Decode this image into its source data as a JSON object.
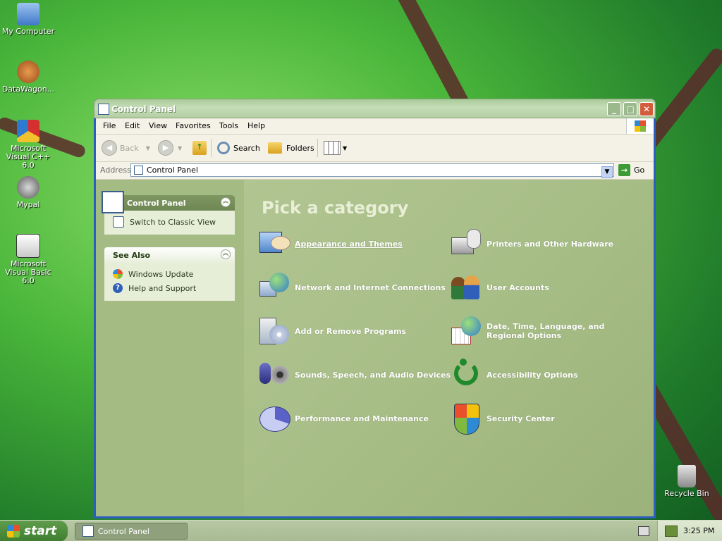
{
  "desktop": {
    "icons": [
      {
        "label": "My Computer"
      },
      {
        "label": "DataWagon..."
      },
      {
        "label": "Microsoft Visual C++ 6.0"
      },
      {
        "label": "Mypal"
      },
      {
        "label": "Microsoft Visual Basic 6.0"
      },
      {
        "label": "Recycle Bin"
      }
    ]
  },
  "window": {
    "title": "Control Panel",
    "menu": [
      "File",
      "Edit",
      "View",
      "Favorites",
      "Tools",
      "Help"
    ],
    "toolbar": {
      "back": "Back",
      "search": "Search",
      "folders": "Folders"
    },
    "address": {
      "label": "Address",
      "value": "Control Panel",
      "go": "Go"
    }
  },
  "left_pane": {
    "control_panel_box": {
      "title": "Control Panel",
      "tasks": [
        "Switch to Classic View"
      ]
    },
    "see_also_box": {
      "title": "See Also",
      "links": [
        "Windows Update",
        "Help and Support"
      ]
    }
  },
  "main": {
    "heading": "Pick a category",
    "categories": [
      {
        "label": "Appearance and Themes",
        "icon": "appearance-themes-icon"
      },
      {
        "label": "Printers and Other Hardware",
        "icon": "printers-hardware-icon"
      },
      {
        "label": "Network and Internet Connections",
        "icon": "network-internet-icon"
      },
      {
        "label": "User Accounts",
        "icon": "user-accounts-icon"
      },
      {
        "label": "Add or Remove Programs",
        "icon": "add-remove-programs-icon"
      },
      {
        "label": "Date, Time, Language, and Regional Options",
        "icon": "date-time-language-icon"
      },
      {
        "label": "Sounds, Speech, and Audio Devices",
        "icon": "sounds-speech-audio-icon"
      },
      {
        "label": "Accessibility Options",
        "icon": "accessibility-icon"
      },
      {
        "label": "Performance and Maintenance",
        "icon": "performance-maintenance-icon"
      },
      {
        "label": "Security Center",
        "icon": "security-center-icon"
      }
    ]
  },
  "taskbar": {
    "start_label": "start",
    "task_button": "Control Panel",
    "clock": "3:25 PM"
  }
}
